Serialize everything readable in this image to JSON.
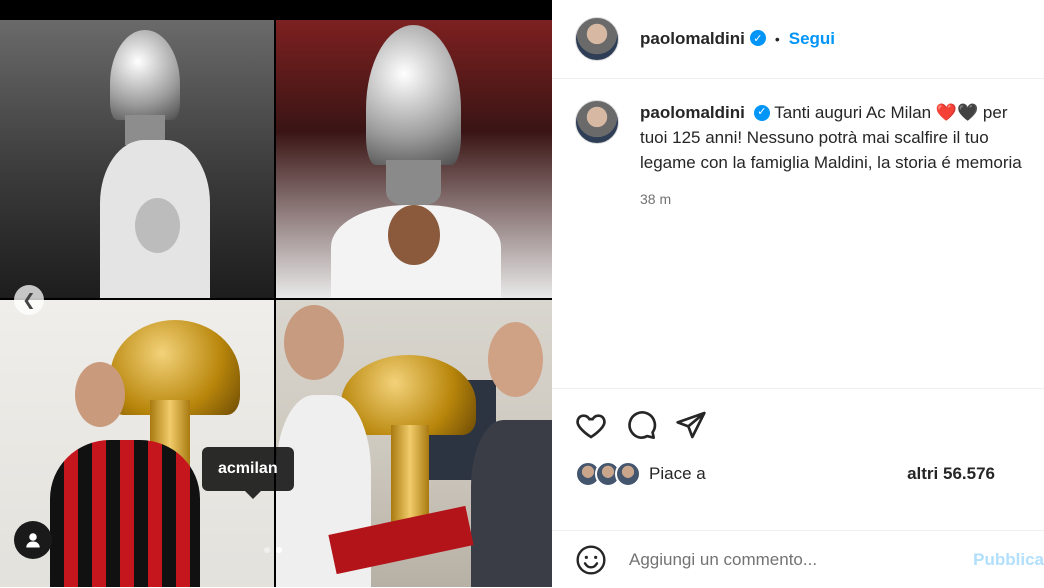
{
  "post": {
    "author": "paolomaldini",
    "follow_label": "Segui",
    "separator": "•",
    "caption": "Tanti auguri Ac Milan ❤️🖤 per tuoi 125 anni! Nessuno potrà mai scalfire il tuo legame con la famiglia Maldini, la storia é memoria",
    "time_ago": "38 m",
    "tagged_user": "acmilan",
    "likes_prefix": "Piace a",
    "likes_suffix": "altri 56.576",
    "comment_placeholder": "Aggiungi un commento...",
    "publish_label": "Pubblica",
    "carousel_count": 2,
    "carousel_active_index": 2
  },
  "icons": {
    "verified": "verified-badge-icon",
    "prev": "chevron-left-icon",
    "tags": "user-tag-icon",
    "like": "heart-icon",
    "comment": "comment-bubble-icon",
    "share": "paper-plane-icon",
    "emoji": "smiley-icon"
  },
  "colors": {
    "link": "#0095f6",
    "text": "#262626",
    "muted": "#737373",
    "publish_disabled": "#b2dffc"
  }
}
